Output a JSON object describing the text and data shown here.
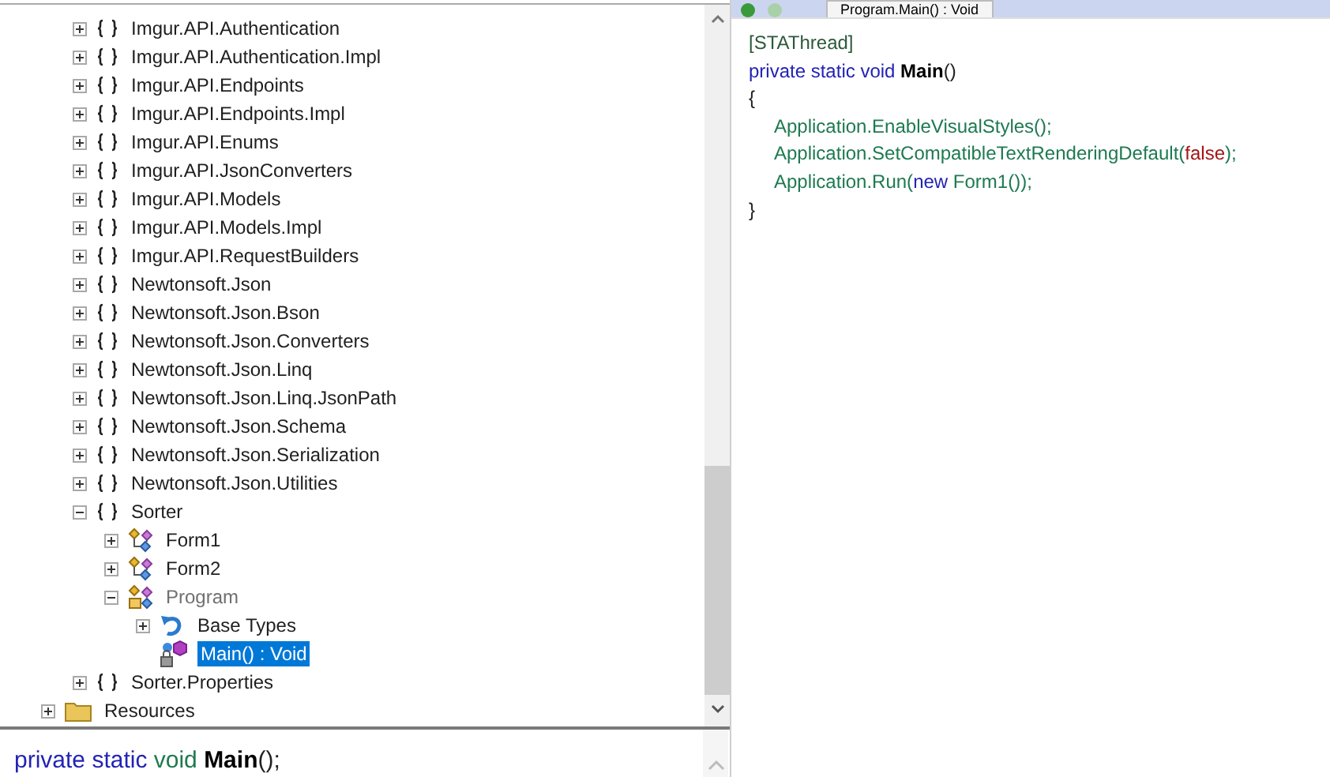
{
  "editor_tab": {
    "label": "Program.Main() : Void"
  },
  "tree": [
    {
      "label": "Imgur.API.Authentication",
      "kind": "namespace",
      "expanded": false,
      "selected": false
    },
    {
      "label": "Imgur.API.Authentication.Impl",
      "kind": "namespace",
      "expanded": false,
      "selected": false
    },
    {
      "label": "Imgur.API.Endpoints",
      "kind": "namespace",
      "expanded": false,
      "selected": false
    },
    {
      "label": "Imgur.API.Endpoints.Impl",
      "kind": "namespace",
      "expanded": false,
      "selected": false
    },
    {
      "label": "Imgur.API.Enums",
      "kind": "namespace",
      "expanded": false,
      "selected": false
    },
    {
      "label": "Imgur.API.JsonConverters",
      "kind": "namespace",
      "expanded": false,
      "selected": false
    },
    {
      "label": "Imgur.API.Models",
      "kind": "namespace",
      "expanded": false,
      "selected": false
    },
    {
      "label": "Imgur.API.Models.Impl",
      "kind": "namespace",
      "expanded": false,
      "selected": false
    },
    {
      "label": "Imgur.API.RequestBuilders",
      "kind": "namespace",
      "expanded": false,
      "selected": false
    },
    {
      "label": "Newtonsoft.Json",
      "kind": "namespace",
      "expanded": false,
      "selected": false
    },
    {
      "label": "Newtonsoft.Json.Bson",
      "kind": "namespace",
      "expanded": false,
      "selected": false
    },
    {
      "label": "Newtonsoft.Json.Converters",
      "kind": "namespace",
      "expanded": false,
      "selected": false
    },
    {
      "label": "Newtonsoft.Json.Linq",
      "kind": "namespace",
      "expanded": false,
      "selected": false
    },
    {
      "label": "Newtonsoft.Json.Linq.JsonPath",
      "kind": "namespace",
      "expanded": false,
      "selected": false
    },
    {
      "label": "Newtonsoft.Json.Schema",
      "kind": "namespace",
      "expanded": false,
      "selected": false
    },
    {
      "label": "Newtonsoft.Json.Serialization",
      "kind": "namespace",
      "expanded": false,
      "selected": false
    },
    {
      "label": "Newtonsoft.Json.Utilities",
      "kind": "namespace",
      "expanded": false,
      "selected": false
    },
    {
      "label": "Sorter",
      "kind": "namespace",
      "expanded": true,
      "selected": false,
      "children": [
        {
          "label": "Form1",
          "kind": "class",
          "expanded": false,
          "selected": false
        },
        {
          "label": "Form2",
          "kind": "class",
          "expanded": false,
          "selected": false
        },
        {
          "label": "Program",
          "kind": "static-class",
          "expanded": true,
          "selected": false,
          "children": [
            {
              "label": "Base Types",
              "kind": "base-types",
              "expanded": false,
              "selected": false
            },
            {
              "label": "Main() : Void",
              "kind": "method",
              "selected": true
            }
          ]
        }
      ]
    },
    {
      "label": "Sorter.Properties",
      "kind": "namespace",
      "expanded": false,
      "selected": false
    },
    {
      "label": "Resources",
      "kind": "folder",
      "outdent": true,
      "expanded": false,
      "selected": false
    }
  ],
  "code": [
    [
      {
        "kind": "attribute",
        "text": "[STAThread]"
      }
    ],
    [
      {
        "kind": "keyword",
        "text": "private static void "
      },
      {
        "kind": "name",
        "text": "Main"
      },
      {
        "kind": "plain",
        "text": "()"
      }
    ],
    [
      {
        "kind": "plain",
        "text": "{"
      }
    ],
    [
      {
        "kind": "indent"
      },
      {
        "kind": "type",
        "text": "Application.EnableVisualStyles();"
      }
    ],
    [
      {
        "kind": "indent"
      },
      {
        "kind": "type",
        "text": "Application.SetCompatibleTextRenderingDefault("
      },
      {
        "kind": "literal",
        "text": "false"
      },
      {
        "kind": "type",
        "text": ");"
      }
    ],
    [
      {
        "kind": "indent"
      },
      {
        "kind": "type",
        "text": "Application.Run("
      },
      {
        "kind": "keyword",
        "text": "new "
      },
      {
        "kind": "type",
        "text": "Form1());"
      }
    ],
    [
      {
        "kind": "plain",
        "text": "}"
      }
    ]
  ],
  "declaration": [
    {
      "kind": "keyword",
      "text": "private static "
    },
    {
      "kind": "type",
      "text": "void "
    },
    {
      "kind": "name",
      "text": "Main"
    },
    {
      "kind": "plain",
      "text": "();"
    }
  ]
}
